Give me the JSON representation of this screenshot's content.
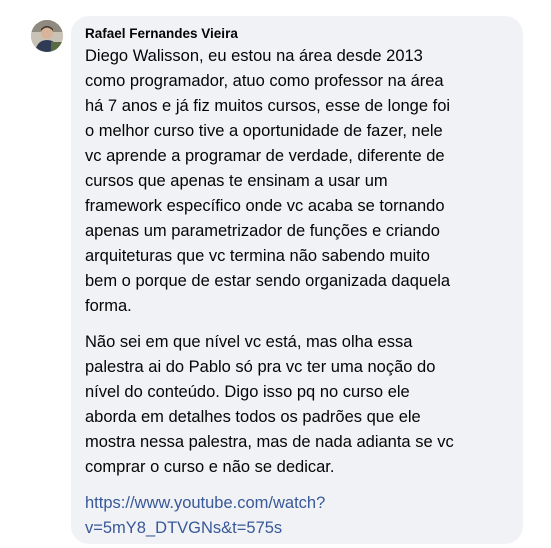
{
  "comment": {
    "author": "Rafael Fernandes Vieira",
    "paragraphs": [
      [
        "Diego Walisson, eu estou na área desde 2013",
        "como programador, atuo como professor na área",
        "há 7 anos e já fiz muitos cursos, esse de longe foi",
        "o melhor curso tive a oportunidade de fazer, nele",
        "vc aprende a programar de verdade, diferente de",
        "cursos que apenas te ensinam a usar um",
        "framework específico onde vc acaba se tornando",
        "apenas um parametrizador de funções e criando",
        "arquiteturas que vc termina não sabendo muito",
        "bem o porque de estar sendo organizada daquela",
        "forma."
      ],
      [
        "Não sei em que nível vc está, mas olha essa",
        "palestra ai do Pablo só pra vc ter uma noção do",
        "nível do conteúdo. Digo isso pq no curso ele",
        "aborda em detalhes todos os padrões que ele",
        "mostra nessa palestra, mas de nada adianta se vc",
        "comprar o curso e não se dedicar."
      ]
    ],
    "link": {
      "line1": "https://www.youtube.com/watch?",
      "line2": "v=5mY8_DTVGNs&t=575s",
      "color": "#385898"
    },
    "bubble_color": "#f0f2f5",
    "text_color": "#050505"
  }
}
